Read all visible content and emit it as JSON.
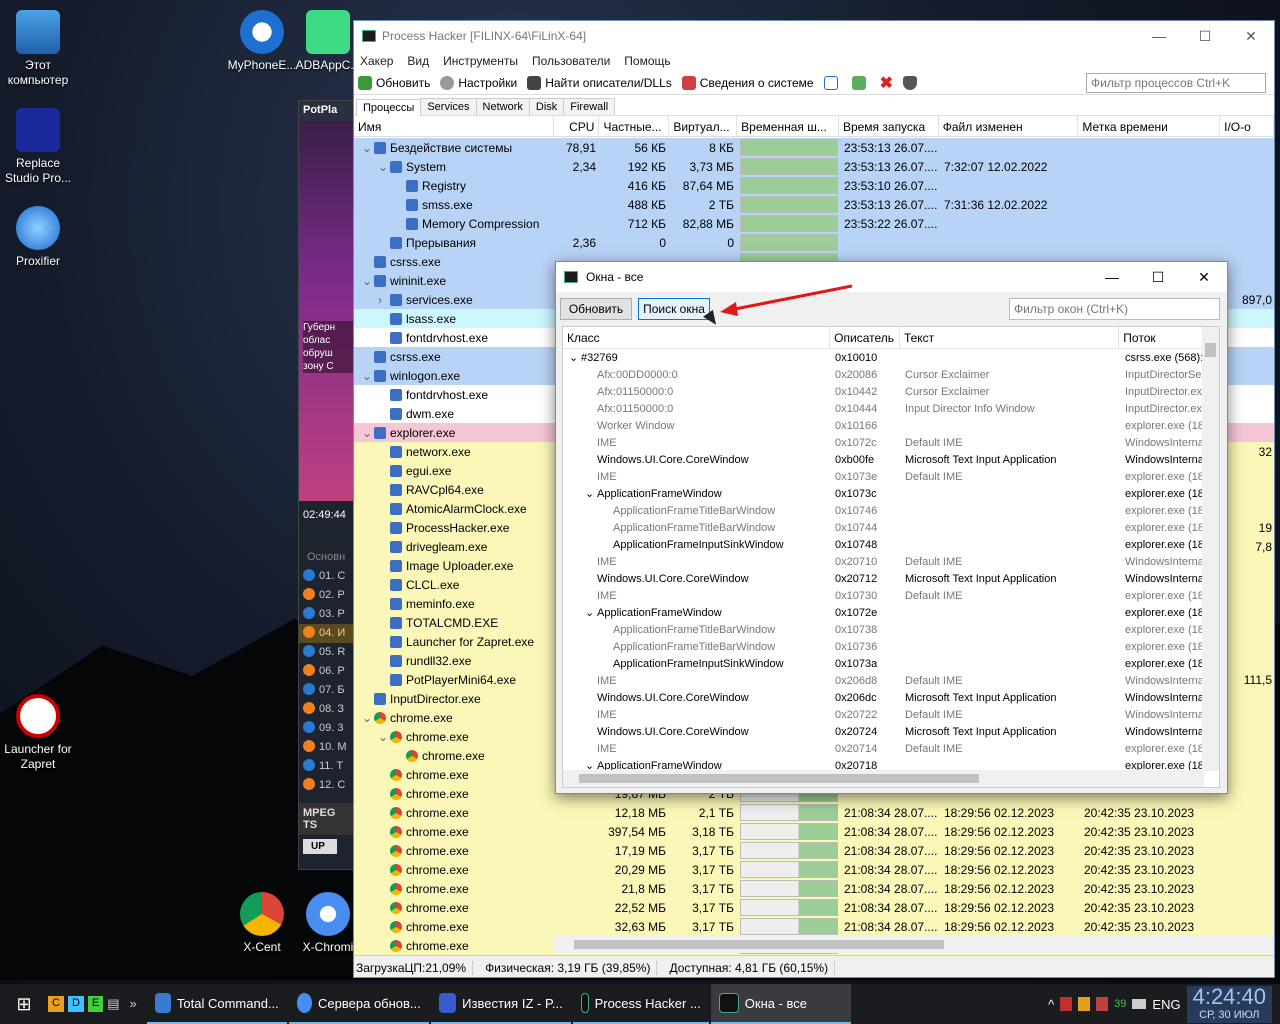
{
  "desktop": {
    "icons": [
      {
        "label": "Этот компьютер"
      },
      {
        "label": "Replace Studio Pro..."
      },
      {
        "label": "Proxifier"
      },
      {
        "label": "Launcher for Zapret"
      },
      {
        "label": "MyPhoneE..."
      },
      {
        "label": "ADBAppC..."
      },
      {
        "label": "X-Cent"
      },
      {
        "label": "X-Chromi"
      }
    ]
  },
  "potplayer": {
    "title": "PotPla",
    "time": "02:49:44",
    "items": [
      "01. C",
      "02. P",
      "03. P",
      "04. И",
      "05. R",
      "06. P",
      "07. Б",
      "08. З",
      "09. 3",
      "10. M",
      "11. T",
      "12. C"
    ],
    "section": "Основн",
    "mpeg": "MPEG TS",
    "up": "UP",
    "overlay": "Губерн облас обруш зону С"
  },
  "main": {
    "title": "Process Hacker [FILINX-64\\FiLinX-64]",
    "menu": [
      "Хакер",
      "Вид",
      "Инструменты",
      "Пользователи",
      "Помощь"
    ],
    "toolbar": {
      "refresh": "Обновить",
      "options": "Настройки",
      "find": "Найти описатели/DLLs",
      "sysinfo": "Сведения о системе"
    },
    "filter_placeholder": "Фильтр процессов Ctrl+K",
    "tabs": [
      "Процессы",
      "Services",
      "Network",
      "Disk",
      "Firewall"
    ],
    "columns": [
      "Имя",
      "CPU",
      "Частные...",
      "Виртуал...",
      "Временная ш...",
      "Время запуска",
      "Файл изменен",
      "Метка времени",
      "I/O-o"
    ],
    "rows": [
      {
        "name": "Бездействие системы",
        "cpu": "78,91",
        "priv": "56 КБ",
        "virt": "8 КБ",
        "start": "23:53:13 26.07....",
        "mod": "",
        "ts": "",
        "io": "",
        "lvl": 0,
        "bg": "#b9d3f6"
      },
      {
        "name": "System",
        "cpu": "2,34",
        "priv": "192 КБ",
        "virt": "3,73 МБ",
        "start": "23:53:13 26.07....",
        "mod": "7:32:07 12.02.2022",
        "ts": "",
        "io": "",
        "lvl": 1,
        "bg": "#b9d3f6"
      },
      {
        "name": "Registry",
        "cpu": "",
        "priv": "416 КБ",
        "virt": "87,64 МБ",
        "start": "23:53:10 26.07....",
        "mod": "",
        "ts": "",
        "io": "",
        "lvl": 2,
        "bg": "#b9d3f6"
      },
      {
        "name": "smss.exe",
        "cpu": "",
        "priv": "488 КБ",
        "virt": "2 ТБ",
        "start": "23:53:13 26.07....",
        "mod": "7:31:36 12.02.2022",
        "ts": "",
        "io": "",
        "lvl": 2,
        "bg": "#b9d3f6"
      },
      {
        "name": "Memory Compression",
        "cpu": "",
        "priv": "712 КБ",
        "virt": "82,88 МБ",
        "start": "23:53:22 26.07....",
        "mod": "",
        "ts": "",
        "io": "",
        "lvl": 2,
        "bg": "#b9d3f6"
      },
      {
        "name": "Прерывания",
        "cpu": "2,36",
        "priv": "0",
        "virt": "0",
        "start": "",
        "mod": "",
        "ts": "",
        "io": "",
        "lvl": 1,
        "bg": "#b9d3f6"
      },
      {
        "name": "csrss.exe",
        "cpu": "",
        "priv": "",
        "virt": "",
        "start": "",
        "mod": "",
        "ts": "",
        "io": "",
        "lvl": 0,
        "bg": "#b9d3f6"
      },
      {
        "name": "wininit.exe",
        "cpu": "",
        "priv": "",
        "virt": "",
        "start": "",
        "mod": "",
        "ts": "",
        "io": "",
        "lvl": 0,
        "bg": "#b9d3f6"
      },
      {
        "name": "services.exe",
        "cpu": "",
        "priv": "",
        "virt": "",
        "start": "",
        "mod": "",
        "ts": "",
        "io": "897,0",
        "lvl": 1,
        "bg": "#b9d3f6"
      },
      {
        "name": "lsass.exe",
        "cpu": "",
        "priv": "",
        "virt": "",
        "start": "",
        "mod": "",
        "ts": "",
        "io": "",
        "lvl": 1,
        "bg": "#cdf7ff"
      },
      {
        "name": "fontdrvhost.exe",
        "cpu": "",
        "priv": "",
        "virt": "",
        "start": "",
        "mod": "",
        "ts": "",
        "io": "",
        "lvl": 1,
        "bg": "#ffffff"
      },
      {
        "name": "csrss.exe",
        "cpu": "",
        "priv": "",
        "virt": "",
        "start": "",
        "mod": "",
        "ts": "",
        "io": "",
        "lvl": 0,
        "bg": "#b9d3f6"
      },
      {
        "name": "winlogon.exe",
        "cpu": "",
        "priv": "",
        "virt": "",
        "start": "",
        "mod": "",
        "ts": "",
        "io": "",
        "lvl": 0,
        "bg": "#b9d3f6"
      },
      {
        "name": "fontdrvhost.exe",
        "cpu": "",
        "priv": "",
        "virt": "",
        "start": "",
        "mod": "",
        "ts": "",
        "io": "",
        "lvl": 1,
        "bg": "#ffffff"
      },
      {
        "name": "dwm.exe",
        "cpu": "",
        "priv": "",
        "virt": "",
        "start": "",
        "mod": "",
        "ts": "",
        "io": "",
        "lvl": 1,
        "bg": "#ffffff"
      },
      {
        "name": "explorer.exe",
        "cpu": "",
        "priv": "",
        "virt": "",
        "start": "",
        "mod": "",
        "ts": "",
        "io": "",
        "lvl": 0,
        "bg": "#f7c6d6"
      },
      {
        "name": "networx.exe",
        "cpu": "",
        "priv": "",
        "virt": "",
        "start": "",
        "mod": "",
        "ts": "",
        "io": "32",
        "lvl": 1,
        "bg": "#fbf7b8"
      },
      {
        "name": "egui.exe",
        "cpu": "",
        "priv": "",
        "virt": "",
        "start": "",
        "mod": "",
        "ts": "",
        "io": "",
        "lvl": 1,
        "bg": "#fbf7b8"
      },
      {
        "name": "RAVCpl64.exe",
        "cpu": "",
        "priv": "",
        "virt": "",
        "start": "",
        "mod": "",
        "ts": "",
        "io": "",
        "lvl": 1,
        "bg": "#fbf7b8"
      },
      {
        "name": "AtomicAlarmClock.exe",
        "cpu": "",
        "priv": "",
        "virt": "",
        "start": "",
        "mod": "",
        "ts": "",
        "io": "",
        "lvl": 1,
        "bg": "#fbf7b8"
      },
      {
        "name": "ProcessHacker.exe",
        "cpu": "",
        "priv": "",
        "virt": "",
        "start": "",
        "mod": "",
        "ts": "",
        "io": "19",
        "lvl": 1,
        "bg": "#fbf7b8"
      },
      {
        "name": "drivegleam.exe",
        "cpu": "",
        "priv": "",
        "virt": "",
        "start": "",
        "mod": "",
        "ts": "",
        "io": "7,8",
        "lvl": 1,
        "bg": "#fbf7b8"
      },
      {
        "name": "Image Uploader.exe",
        "cpu": "",
        "priv": "",
        "virt": "",
        "start": "",
        "mod": "",
        "ts": "",
        "io": "",
        "lvl": 1,
        "bg": "#fbf7b8"
      },
      {
        "name": "CLCL.exe",
        "cpu": "",
        "priv": "",
        "virt": "",
        "start": "",
        "mod": "",
        "ts": "",
        "io": "",
        "lvl": 1,
        "bg": "#fbf7b8"
      },
      {
        "name": "meminfo.exe",
        "cpu": "",
        "priv": "",
        "virt": "",
        "start": "",
        "mod": "",
        "ts": "",
        "io": "",
        "lvl": 1,
        "bg": "#fbf7b8"
      },
      {
        "name": "TOTALCMD.EXE",
        "cpu": "",
        "priv": "",
        "virt": "",
        "start": "",
        "mod": "",
        "ts": "",
        "io": "",
        "lvl": 1,
        "bg": "#fbf7b8"
      },
      {
        "name": "Launcher for Zapret.exe",
        "cpu": "",
        "priv": "",
        "virt": "",
        "start": "",
        "mod": "",
        "ts": "",
        "io": "",
        "lvl": 1,
        "bg": "#fbf7b8"
      },
      {
        "name": "rundll32.exe",
        "cpu": "",
        "priv": "",
        "virt": "",
        "start": "",
        "mod": "",
        "ts": "",
        "io": "",
        "lvl": 1,
        "bg": "#fbf7b8"
      },
      {
        "name": "PotPlayerMini64.exe",
        "cpu": "",
        "priv": "",
        "virt": "",
        "start": "",
        "mod": "",
        "ts": "",
        "io": "111,5",
        "lvl": 1,
        "bg": "#fbf7b8"
      },
      {
        "name": "InputDirector.exe",
        "cpu": "",
        "priv": "",
        "virt": "",
        "start": "",
        "mod": "",
        "ts": "",
        "io": "",
        "lvl": 0,
        "bg": "#fbf7b8"
      },
      {
        "name": "chrome.exe",
        "cpu": "",
        "priv": "",
        "virt": "",
        "start": "",
        "mod": "",
        "ts": "",
        "io": "",
        "lvl": 0,
        "bg": "#fbf7b8"
      },
      {
        "name": "chrome.exe",
        "cpu": "",
        "priv": "",
        "virt": "",
        "start": "",
        "mod": "",
        "ts": "",
        "io": "",
        "lvl": 1,
        "bg": "#fbf7b8"
      },
      {
        "name": "chrome.exe",
        "cpu": "",
        "priv": "",
        "virt": "",
        "start": "",
        "mod": "",
        "ts": "",
        "io": "",
        "lvl": 2,
        "bg": "#fbf7b8"
      },
      {
        "name": "chrome.exe",
        "cpu": "",
        "priv": "",
        "virt": "",
        "start": "",
        "mod": "",
        "ts": "",
        "io": "",
        "lvl": 1,
        "bg": "#fbf7b8"
      },
      {
        "name": "chrome.exe",
        "cpu": "",
        "priv": "19,87 МБ",
        "virt": "2 ТБ",
        "start": "",
        "mod": "",
        "ts": "",
        "io": "",
        "lvl": 1,
        "bg": "#fbf7b8"
      },
      {
        "name": "chrome.exe",
        "cpu": "",
        "priv": "12,18 МБ",
        "virt": "2,1 ТБ",
        "start": "21:08:34 28.07....",
        "mod": "18:29:56 02.12.2023",
        "ts": "20:42:35 23.10.2023",
        "io": "",
        "lvl": 1,
        "bg": "#fbf7b8"
      },
      {
        "name": "chrome.exe",
        "cpu": "",
        "priv": "397,54 МБ",
        "virt": "3,18 ТБ",
        "start": "21:08:34 28.07....",
        "mod": "18:29:56 02.12.2023",
        "ts": "20:42:35 23.10.2023",
        "io": "",
        "lvl": 1,
        "bg": "#fbf7b8"
      },
      {
        "name": "chrome.exe",
        "cpu": "",
        "priv": "17,19 МБ",
        "virt": "3,17 ТБ",
        "start": "21:08:34 28.07....",
        "mod": "18:29:56 02.12.2023",
        "ts": "20:42:35 23.10.2023",
        "io": "",
        "lvl": 1,
        "bg": "#fbf7b8"
      },
      {
        "name": "chrome.exe",
        "cpu": "",
        "priv": "20,29 МБ",
        "virt": "3,17 ТБ",
        "start": "21:08:34 28.07....",
        "mod": "18:29:56 02.12.2023",
        "ts": "20:42:35 23.10.2023",
        "io": "",
        "lvl": 1,
        "bg": "#fbf7b8"
      },
      {
        "name": "chrome.exe",
        "cpu": "",
        "priv": "21,8 МБ",
        "virt": "3,17 ТБ",
        "start": "21:08:34 28.07....",
        "mod": "18:29:56 02.12.2023",
        "ts": "20:42:35 23.10.2023",
        "io": "",
        "lvl": 1,
        "bg": "#fbf7b8"
      },
      {
        "name": "chrome.exe",
        "cpu": "",
        "priv": "22,52 МБ",
        "virt": "3,17 ТБ",
        "start": "21:08:34 28.07....",
        "mod": "18:29:56 02.12.2023",
        "ts": "20:42:35 23.10.2023",
        "io": "",
        "lvl": 1,
        "bg": "#fbf7b8"
      },
      {
        "name": "chrome.exe",
        "cpu": "",
        "priv": "32,63 МБ",
        "virt": "3,17 ТБ",
        "start": "21:08:34 28.07....",
        "mod": "18:29:56 02.12.2023",
        "ts": "20:42:35 23.10.2023",
        "io": "",
        "lvl": 1,
        "bg": "#fbf7b8"
      },
      {
        "name": "chrome.exe",
        "cpu": "",
        "priv": "",
        "virt": "",
        "start": "",
        "mod": "",
        "ts": "",
        "io": "",
        "lvl": 1,
        "bg": "#fbf7b8"
      }
    ],
    "status": {
      "cpu": "ЗагрузкаЦП:21,09%",
      "phys": "Физическая:  3,19 ГБ (39,85%)",
      "avail": "Доступная:  4,81 ГБ (60,15%)"
    }
  },
  "dialog": {
    "title": "Окна - все",
    "refresh": "Обновить",
    "find": "Поиск окна",
    "filter_placeholder": "Фильтр окон (Ctrl+K)",
    "columns": [
      "Класс",
      "Описатель",
      "Текст",
      "Поток"
    ],
    "rows": [
      {
        "cls": "#32769",
        "h": "0x10010",
        "t": "",
        "th": "csrss.exe (568):",
        "lvl": 0,
        "exp": "v",
        "gray": false
      },
      {
        "cls": "Afx:00DD0000:0",
        "h": "0x20086",
        "t": "Cursor Exclaimer",
        "th": "InputDirectorSes",
        "lvl": 1,
        "exp": "",
        "gray": true
      },
      {
        "cls": "Afx:01150000:0",
        "h": "0x10442",
        "t": "Cursor Exclaimer",
        "th": "InputDirector.ex",
        "lvl": 1,
        "exp": "",
        "gray": true
      },
      {
        "cls": "Afx:01150000:0",
        "h": "0x10444",
        "t": "Input Director Info Window",
        "th": "InputDirector.ex",
        "lvl": 1,
        "exp": "",
        "gray": true
      },
      {
        "cls": "Worker Window",
        "h": "0x10166",
        "t": "",
        "th": "explorer.exe (18",
        "lvl": 1,
        "exp": "",
        "gray": true
      },
      {
        "cls": "IME",
        "h": "0x1072c",
        "t": "Default IME",
        "th": "WindowsInterna",
        "lvl": 1,
        "exp": "",
        "gray": true
      },
      {
        "cls": "Windows.UI.Core.CoreWindow",
        "h": "0xb00fe",
        "t": "Microsoft Text Input Application",
        "th": "WindowsInterna",
        "lvl": 1,
        "exp": "",
        "gray": false
      },
      {
        "cls": "IME",
        "h": "0x1073e",
        "t": "Default IME",
        "th": "explorer.exe (18",
        "lvl": 1,
        "exp": "",
        "gray": true
      },
      {
        "cls": "ApplicationFrameWindow",
        "h": "0x1073c",
        "t": "",
        "th": "explorer.exe (18",
        "lvl": 1,
        "exp": "v",
        "gray": false
      },
      {
        "cls": "ApplicationFrameTitleBarWindow",
        "h": "0x10746",
        "t": "",
        "th": "explorer.exe (18",
        "lvl": 2,
        "exp": "",
        "gray": true
      },
      {
        "cls": "ApplicationFrameTitleBarWindow",
        "h": "0x10744",
        "t": "",
        "th": "explorer.exe (18",
        "lvl": 2,
        "exp": "",
        "gray": true
      },
      {
        "cls": "ApplicationFrameInputSinkWindow",
        "h": "0x10748",
        "t": "",
        "th": "explorer.exe (18",
        "lvl": 2,
        "exp": "",
        "gray": false
      },
      {
        "cls": "IME",
        "h": "0x20710",
        "t": "Default IME",
        "th": "WindowsInterna",
        "lvl": 1,
        "exp": "",
        "gray": true
      },
      {
        "cls": "Windows.UI.Core.CoreWindow",
        "h": "0x20712",
        "t": "Microsoft Text Input Application",
        "th": "WindowsInterna",
        "lvl": 1,
        "exp": "",
        "gray": false
      },
      {
        "cls": "IME",
        "h": "0x10730",
        "t": "Default IME",
        "th": "explorer.exe (18",
        "lvl": 1,
        "exp": "",
        "gray": true
      },
      {
        "cls": "ApplicationFrameWindow",
        "h": "0x1072e",
        "t": "",
        "th": "explorer.exe (18",
        "lvl": 1,
        "exp": "v",
        "gray": false
      },
      {
        "cls": "ApplicationFrameTitleBarWindow",
        "h": "0x10738",
        "t": "",
        "th": "explorer.exe (18",
        "lvl": 2,
        "exp": "",
        "gray": true
      },
      {
        "cls": "ApplicationFrameTitleBarWindow",
        "h": "0x10736",
        "t": "",
        "th": "explorer.exe (18",
        "lvl": 2,
        "exp": "",
        "gray": true
      },
      {
        "cls": "ApplicationFrameInputSinkWindow",
        "h": "0x1073a",
        "t": "",
        "th": "explorer.exe (18",
        "lvl": 2,
        "exp": "",
        "gray": false
      },
      {
        "cls": "IME",
        "h": "0x206d8",
        "t": "Default IME",
        "th": "WindowsInterna",
        "lvl": 1,
        "exp": "",
        "gray": true
      },
      {
        "cls": "Windows.UI.Core.CoreWindow",
        "h": "0x206dc",
        "t": "Microsoft Text Input Application",
        "th": "WindowsInterna",
        "lvl": 1,
        "exp": "",
        "gray": false
      },
      {
        "cls": "IME",
        "h": "0x20722",
        "t": "Default IME",
        "th": "WindowsInterna",
        "lvl": 1,
        "exp": "",
        "gray": true
      },
      {
        "cls": "Windows.UI.Core.CoreWindow",
        "h": "0x20724",
        "t": "Microsoft Text Input Application",
        "th": "WindowsInterna",
        "lvl": 1,
        "exp": "",
        "gray": false
      },
      {
        "cls": "IME",
        "h": "0x20714",
        "t": "Default IME",
        "th": "explorer.exe (18",
        "lvl": 1,
        "exp": "",
        "gray": true
      },
      {
        "cls": "ApplicationFrameWindow",
        "h": "0x20718",
        "t": "",
        "th": "explorer.exe (18",
        "lvl": 1,
        "exp": "v",
        "gray": false
      }
    ]
  },
  "taskbar": {
    "items": [
      "Total Command...",
      "Сервера обнов...",
      "Известия IZ - P...",
      "Process Hacker ...",
      "Окна - все"
    ],
    "lang": "ENG",
    "time": "4:24:40",
    "date": "СР, 30  ИЮЛ",
    "tray_num": "39",
    "quick": [
      "C",
      "D",
      "E"
    ]
  }
}
